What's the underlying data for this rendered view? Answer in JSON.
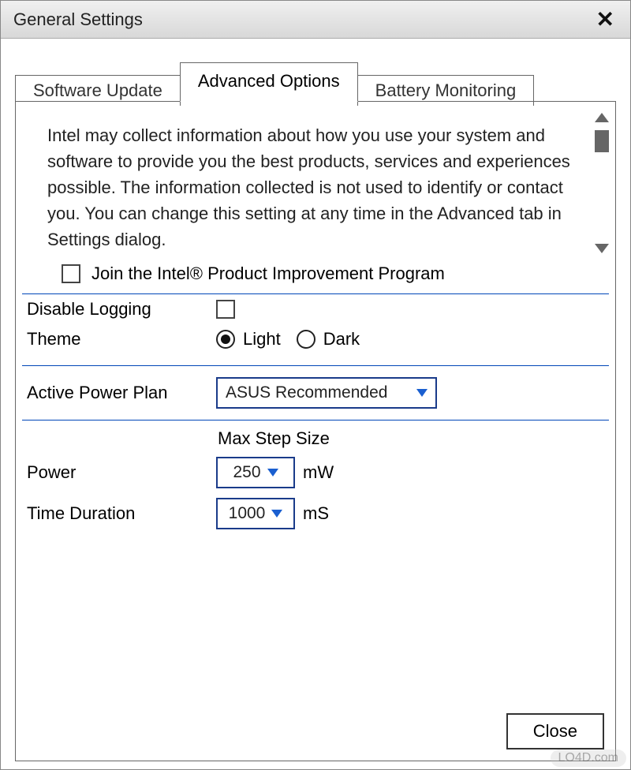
{
  "window": {
    "title": "General Settings",
    "close_symbol": "✕"
  },
  "tabs": {
    "software_update": "Software Update",
    "advanced_options": "Advanced Options",
    "battery_monitoring": "Battery Monitoring"
  },
  "description": "Intel may collect information about how you use your system and software to provide you the best products, services and experiences possible. The information collected is not used to identify or contact you. You can change this setting at any time in the Advanced tab in Settings dialog.",
  "join_label": "Join the Intel® Product Improvement Program",
  "settings": {
    "disable_logging_label": "Disable Logging",
    "theme_label": "Theme",
    "theme_light": "Light",
    "theme_dark": "Dark",
    "theme_value": "Light",
    "active_power_plan_label": "Active Power Plan",
    "active_power_plan_value": "ASUS Recommended",
    "max_step_size_heading": "Max Step Size",
    "power_label": "Power",
    "power_value": "250",
    "power_unit": "mW",
    "time_label": "Time Duration",
    "time_value": "1000",
    "time_unit": "mS"
  },
  "buttons": {
    "close": "Close"
  },
  "watermark": "LO4D.com"
}
